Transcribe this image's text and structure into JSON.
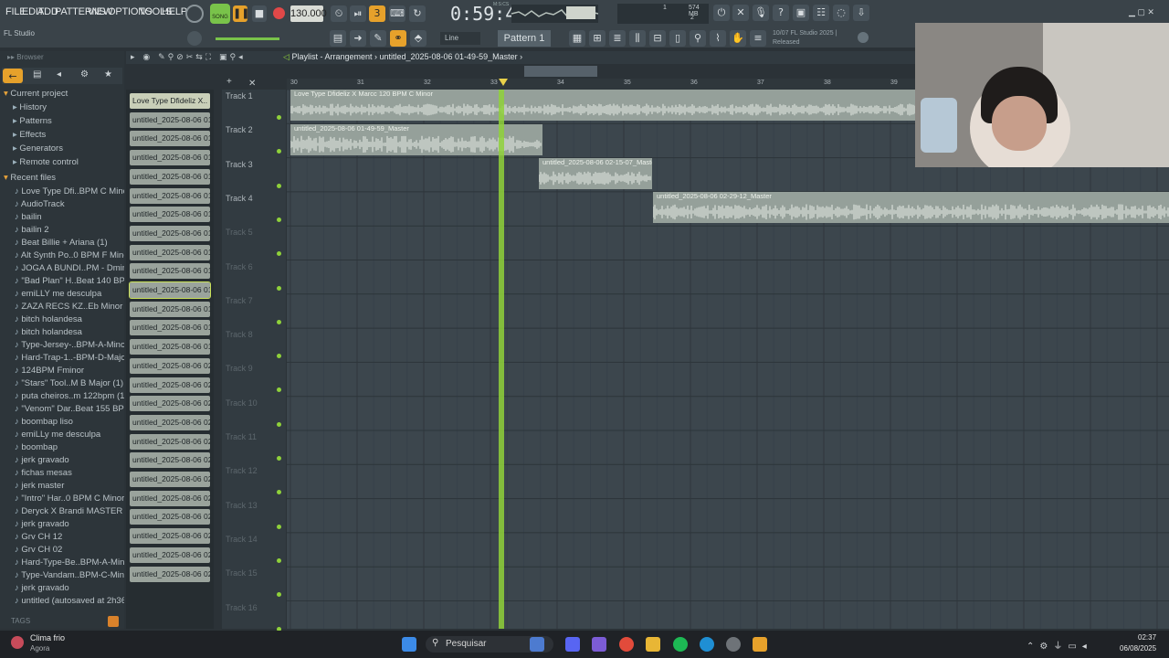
{
  "menu": [
    "FILE",
    "EDIT",
    "ADD",
    "PATTERNS",
    "VIEW",
    "OPTIONS",
    "TOOLS",
    "HELP"
  ],
  "transport": {
    "mode": "SONG",
    "tempo": "130.000",
    "time": "0:59:44",
    "time_unit": "M:S:CS",
    "memory": "574 MB",
    "cpu_top": "1",
    "cpu_bottom": "2"
  },
  "pattern_label": "Pattern 1",
  "snap_label": "Line",
  "hint": {
    "date": "10/07",
    "text1": "FL Studio 2025 |",
    "text2": "Released"
  },
  "hint_bar": "FL Studio",
  "browser": {
    "title": "Browser",
    "sections": [
      "Current project",
      "Recent files"
    ],
    "project_items": [
      "History",
      "Patterns",
      "Effects",
      "Generators",
      "Remote control"
    ],
    "recent_items": [
      "Love Type Dfi..BPM C Minor",
      "AudioTrack",
      "bailin",
      "bailin 2",
      "Beat Billie + Ariana (1)",
      "Alt Synth Po..0 BPM F Minor",
      "JOGA A BUNDI..PM - Dminor",
      "\"Bad Plan\" H..Beat 140 BPM",
      "emiLLY me desculpa",
      "ZAZA RECS KZ..Eb Minor (1)",
      "bitch holandesa",
      "bitch holandesa",
      "Type-Jersey-..BPM-A-Minor",
      "Hard-Trap-1..-BPM-D-Major",
      "124BPM Fminor",
      "\"Stars\" Tool..M B Major (1)",
      "puta cheiros..m 122bpm (1)",
      "\"Venom\" Dar..Beat 155 BPM",
      "boombap liso",
      "emiLLy me desculpa",
      "boombap",
      "jerk gravado",
      "fichas mesas",
      "jerk master",
      "\"Intro\" Har..0 BPM C Minor",
      "Deryck X Brandi MASTER (1)",
      "jerk gravado",
      "Grv CH 12",
      "Grv CH 02",
      "Hard-Type-Be..BPM-A-Minor",
      "Type-Vandam..BPM-C-Minor",
      "jerk gravado",
      "untitled (autosaved at 2h36)"
    ],
    "tags": "TAGS"
  },
  "playlist": {
    "title": "Playlist - Arrangement",
    "file": "untitled_2025-08-06 01-49-59_Master"
  },
  "clips": [
    "Love Type Dfideliz X..",
    "untitled_2025-08-06 01-",
    "untitled_2025-08-06 01-",
    "untitled_2025-08-06 01-",
    "untitled_2025-08-06 01-",
    "untitled_2025-08-06 01-",
    "untitled_2025-08-06 01-",
    "untitled_2025-08-06 01-",
    "untitled_2025-08-06 01-",
    "untitled_2025-08-06 01-",
    "untitled_2025-08-06 01-",
    "untitled_2025-08-06 01-",
    "untitled_2025-08-06 01-",
    "untitled_2025-08-06 01-",
    "untitled_2025-08-06 02-",
    "untitled_2025-08-06 02-",
    "untitled_2025-08-06 02-",
    "untitled_2025-08-06 02-",
    "untitled_2025-08-06 02-",
    "untitled_2025-08-06 02-",
    "untitled_2025-08-06 02-",
    "untitled_2025-08-06 02-",
    "untitled_2025-08-06 02-",
    "untitled_2025-08-06 02-",
    "untitled_2025-08-06 02-",
    "untitled_2025-08-06 02-"
  ],
  "tracks": [
    "Track 1",
    "Track 2",
    "Track 3",
    "Track 4",
    "Track 5",
    "Track 6",
    "Track 7",
    "Track 8",
    "Track 9",
    "Track 10",
    "Track 11",
    "Track 12",
    "Track 13",
    "Track 14",
    "Track 15",
    "Track 16"
  ],
  "ruler": [
    "30",
    "31",
    "32",
    "33",
    "34",
    "35",
    "36",
    "37",
    "38",
    "39"
  ],
  "audio_clips": [
    {
      "label": "Love Type Dfideliz X Marcc 120 BPM C Minor"
    },
    {
      "label": "untitled_2025-08-06 01-49-59_Master"
    },
    {
      "label": "untitled_2025-08-06 02-15-07_Master"
    },
    {
      "label": "untitled_2025-08-06 02-29-12_Master"
    }
  ],
  "taskbar": {
    "weather_title": "Clima frio",
    "weather_sub": "Agora",
    "search": "Pesquisar",
    "time": "02:37",
    "date": "06/08/2025"
  },
  "colors": {
    "accent": "#e6a12b",
    "playhead": "#8fd13a",
    "wave": "#95a09a"
  }
}
